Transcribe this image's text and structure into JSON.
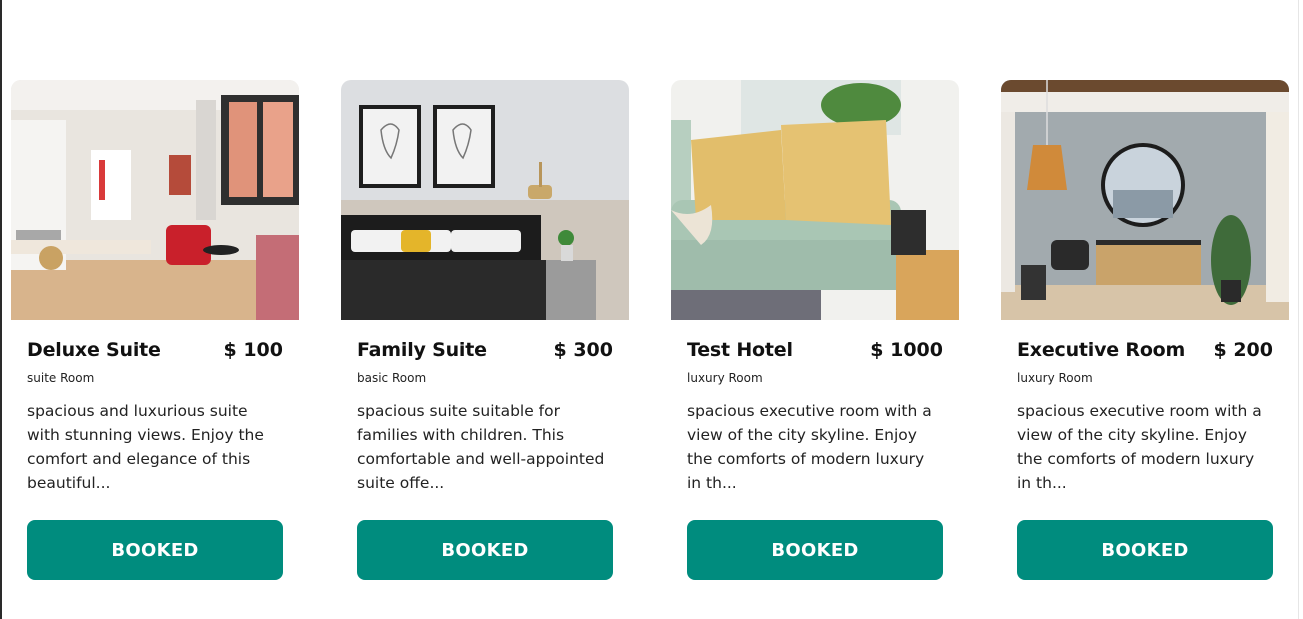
{
  "rooms": [
    {
      "name": "Deluxe Suite",
      "price": "$ 100",
      "type": "suite Room",
      "description": "spacious and luxurious suite with stunning views. Enjoy the comfort and elegance of this beautiful...",
      "button_label": "BOOKED",
      "image": "living-room-photo"
    },
    {
      "name": "Family Suite",
      "price": "$ 300",
      "type": "basic Room",
      "description": "spacious suite suitable for families with children. This comfortable and well-appointed suite offe...",
      "button_label": "BOOKED",
      "image": "bedroom-photo"
    },
    {
      "name": "Test Hotel",
      "price": "$ 1000",
      "type": "luxury Room",
      "description": "spacious executive room with a view of the city skyline. Enjoy the comforts of modern luxury in th...",
      "button_label": "BOOKED",
      "image": "sofa-photo"
    },
    {
      "name": "Executive Room",
      "price": "$ 200",
      "type": "luxury Room",
      "description": "spacious executive room with a view of the city skyline. Enjoy the comforts of modern luxury in th...",
      "button_label": "BOOKED",
      "image": "lounge-photo"
    }
  ],
  "colors": {
    "button": "#008c7e",
    "button_text": "#ffffff",
    "text": "#111111"
  }
}
